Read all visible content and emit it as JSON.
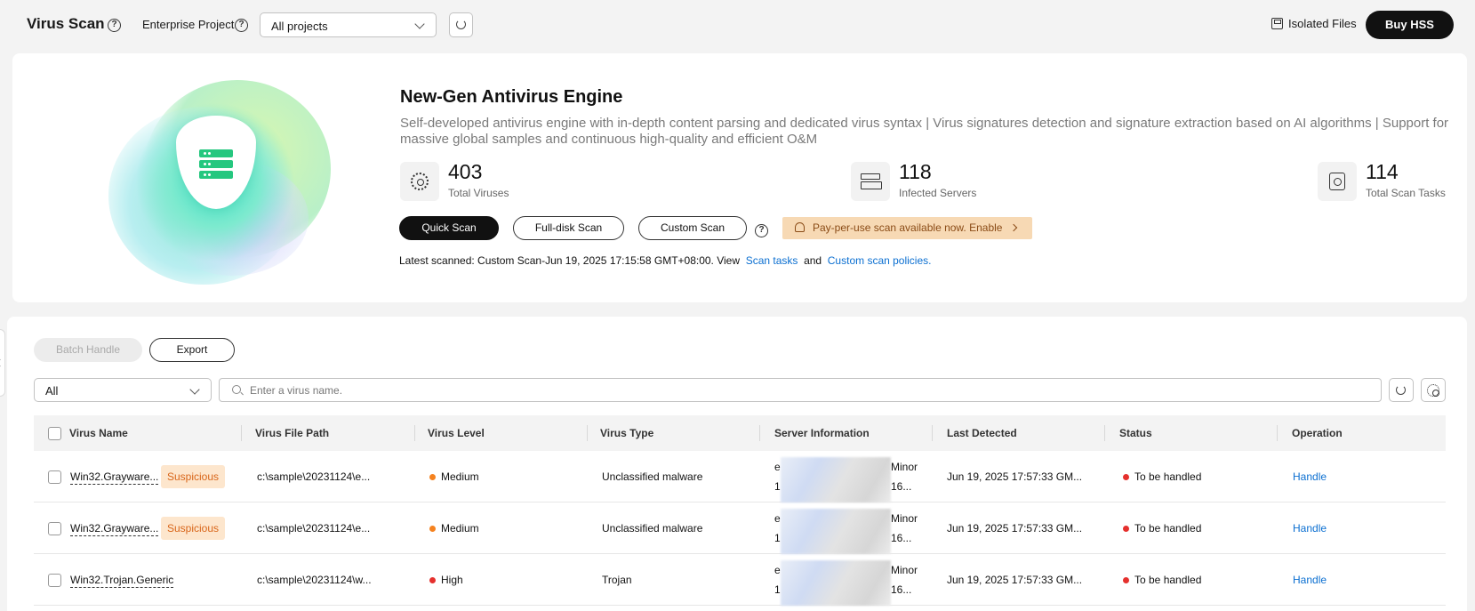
{
  "header": {
    "title": "Virus Scan",
    "enterprise_label": "Enterprise Project",
    "project_select": "All projects",
    "isolated_files": "Isolated Files",
    "buy_button": "Buy HSS"
  },
  "hero": {
    "title": "New-Gen Antivirus Engine",
    "description": "Self-developed antivirus engine with in-depth content parsing and dedicated virus syntax | Virus signatures detection and signature extraction based on AI algorithms | Support for massive global samples and continuous high-quality and efficient O&M",
    "stats": [
      {
        "value": "403",
        "label": "Total Viruses",
        "icon": "virus-gear-icon"
      },
      {
        "value": "118",
        "label": "Infected Servers",
        "icon": "server-icon"
      },
      {
        "value": "114",
        "label": "Total Scan Tasks",
        "icon": "scan-task-icon"
      }
    ],
    "buttons": {
      "quick": "Quick Scan",
      "full": "Full-disk Scan",
      "custom": "Custom Scan"
    },
    "promo": "Pay-per-use scan available now. Enable",
    "latest_prefix": "Latest scanned: Custom Scan-Jun 19, 2025 17:15:58 GMT+08:00. View",
    "link_tasks": "Scan tasks",
    "and": "and",
    "link_policies": "Custom scan policies",
    "period": "."
  },
  "toolbar": {
    "batch": "Batch Handle",
    "export": "Export",
    "filter": "All",
    "search_placeholder": "Enter a virus name."
  },
  "table": {
    "columns": [
      "Virus Name",
      "Virus File Path",
      "Virus Level",
      "Virus Type",
      "Server Information",
      "Last Detected",
      "Status",
      "Operation"
    ],
    "rows": [
      {
        "name": "Win32.Grayware...",
        "badge": "Suspicious",
        "path": "c:\\sample\\20231124\\e...",
        "level": "Medium",
        "level_color": "#f5821f",
        "type": "Unclassified malware",
        "srv_a": "e",
        "srv_b": "Minor",
        "srv_c": "1",
        "srv_d": "16...",
        "detected": "Jun 19, 2025 17:57:33 GM...",
        "status": "To be handled",
        "status_color": "#e5302d",
        "op": "Handle"
      },
      {
        "name": "Win32.Grayware...",
        "badge": "Suspicious",
        "path": "c:\\sample\\20231124\\e...",
        "level": "Medium",
        "level_color": "#f5821f",
        "type": "Unclassified malware",
        "srv_a": "e",
        "srv_b": "Minor",
        "srv_c": "1",
        "srv_d": "16...",
        "detected": "Jun 19, 2025 17:57:33 GM...",
        "status": "To be handled",
        "status_color": "#e5302d",
        "op": "Handle"
      },
      {
        "name": "Win32.Trojan.Generic",
        "badge": "",
        "path": "c:\\sample\\20231124\\w...",
        "level": "High",
        "level_color": "#e5302d",
        "type": "Trojan",
        "srv_a": "e",
        "srv_b": "Minor",
        "srv_c": "1",
        "srv_d": "16...",
        "detected": "Jun 19, 2025 17:57:33 GM...",
        "status": "To be handled",
        "status_color": "#e5302d",
        "op": "Handle"
      }
    ]
  }
}
